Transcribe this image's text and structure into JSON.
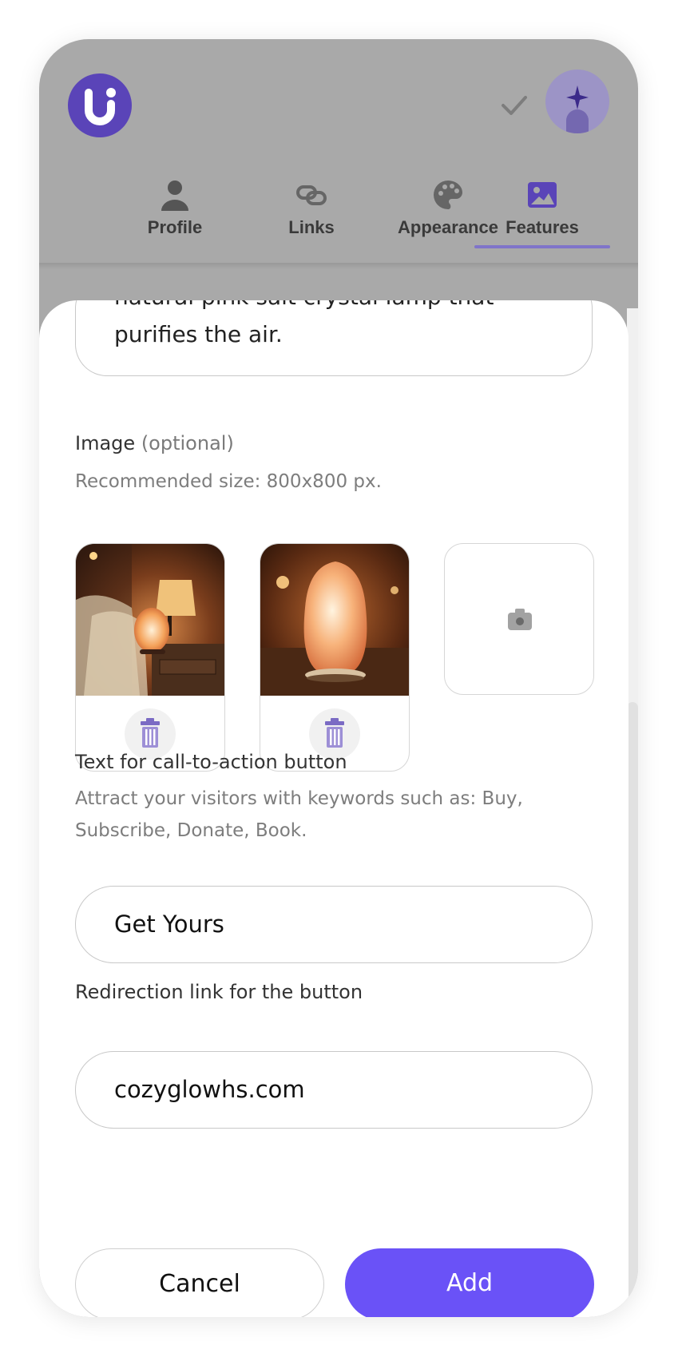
{
  "header": {
    "logo_icon": "brand-logo-icon",
    "check_icon": "check-icon",
    "avatar_icon": "sparkle-avatar-icon"
  },
  "tabs": [
    {
      "label": "Profile",
      "icon": "person-icon"
    },
    {
      "label": "Links",
      "icon": "link-icon"
    },
    {
      "label": "Appearance",
      "icon": "palette-icon"
    },
    {
      "label": "Features",
      "icon": "image-icon",
      "active": true
    }
  ],
  "form": {
    "description_lines": [
      "natural pink salt crystal lamp that",
      "purifies the air."
    ],
    "image": {
      "label": "Image",
      "label_optional": "(optional)",
      "hint": "Recommended size: 800x800 px.",
      "images": [
        "salt-lamp-bedroom",
        "salt-lamp-closeup"
      ],
      "upload_icon": "camera-icon"
    },
    "cta": {
      "label": "Text for call-to-action button",
      "hint_line1": "Attract your visitors with keywords such as: Buy,",
      "hint_line2": "Subscribe, Donate, Book.",
      "value": "Get Yours"
    },
    "redirect": {
      "label": "Redirection link for the button",
      "value": "cozyglowhs.com"
    }
  },
  "actions": {
    "cancel_label": "Cancel",
    "add_label": "Add"
  },
  "colors": {
    "accent": "#6a52f7",
    "brand": "#5a44b8",
    "overlay": "#a9a9a9"
  }
}
